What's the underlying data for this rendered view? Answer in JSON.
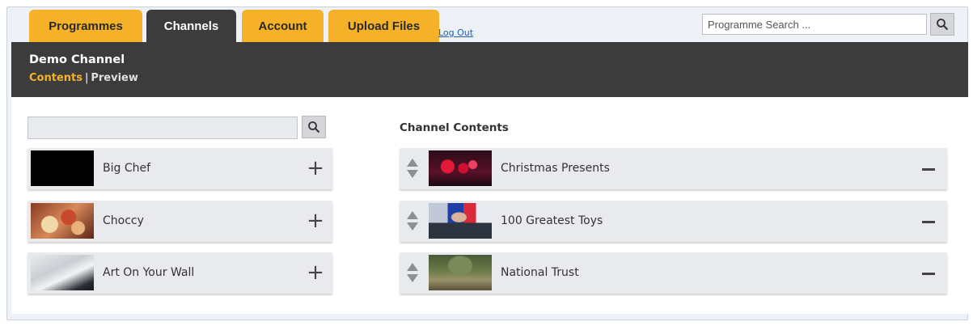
{
  "tabs": [
    {
      "label": "Programmes",
      "active": false
    },
    {
      "label": "Channels",
      "active": true
    },
    {
      "label": "Account",
      "active": false
    },
    {
      "label": "Upload Files",
      "active": false
    }
  ],
  "logout_label": "Log Out",
  "programme_search": {
    "placeholder": "Programme Search ...",
    "icon": "search-icon"
  },
  "channel": {
    "title": "Demo Channel",
    "subnav": {
      "current": "Contents",
      "other": "Preview"
    }
  },
  "library": {
    "search": {
      "value": "",
      "icon": "search-icon"
    },
    "items": [
      {
        "title": "Big Chef",
        "action_icon": "plus-icon"
      },
      {
        "title": "Choccy",
        "action_icon": "plus-icon"
      },
      {
        "title": "Art On Your Wall",
        "action_icon": "plus-icon"
      }
    ]
  },
  "channel_contents": {
    "heading": "Channel Contents",
    "items": [
      {
        "title": "Christmas Presents",
        "action_icon": "minus-icon"
      },
      {
        "title": "100 Greatest Toys",
        "action_icon": "minus-icon"
      },
      {
        "title": "National Trust",
        "action_icon": "minus-icon"
      }
    ]
  },
  "colors": {
    "accent": "#f5b128",
    "header_dark": "#3c3c3c",
    "card_bg": "#e9eaed",
    "link": "#1a5fb4"
  }
}
